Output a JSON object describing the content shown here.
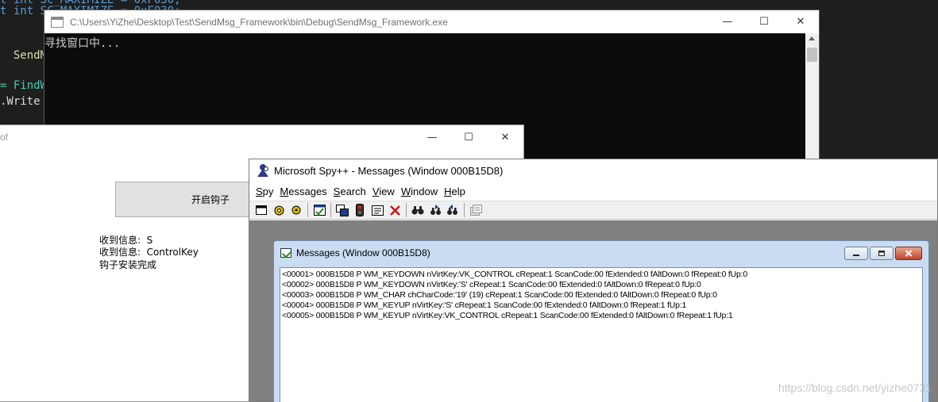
{
  "editor": {
    "lines": [
      {
        "text": "t int SC_MAXIMIZE = 0xF030;",
        "cls": "kw"
      },
      {
        "text": "  SendMs",
        "cls": "pale"
      },
      {
        "text": "= FindW",
        "cls": "grn"
      },
      {
        "text": ".Write",
        "cls": "ident"
      }
    ],
    "partial_top": "t int SC_MAXIMIZE = 0xF030;"
  },
  "console": {
    "title": "C:\\Users\\YiZhe\\Desktop\\Test\\SendMsg_Framework\\bin\\Debug\\SendMsg_Framework.exe",
    "output": "寻找窗口中...",
    "controls": {
      "minimize": "—",
      "maximize": "☐",
      "close": "✕"
    }
  },
  "hook_window": {
    "title": "of",
    "button_label": "开启钩子",
    "info": [
      "收到信息:  S",
      "收到信息:  ControlKey",
      "钩子安装完成"
    ],
    "controls": {
      "minimize": "—",
      "maximize": "☐",
      "close": "✕"
    }
  },
  "spy": {
    "title": "Microsoft Spy++ - Messages (Window 000B15D8)",
    "menu": [
      {
        "label": "Spy",
        "accel": "S",
        "rest": "py"
      },
      {
        "label": "Messages",
        "accel": "M",
        "rest": "essages"
      },
      {
        "label": "Search",
        "accel": "S",
        "rest": "earch"
      },
      {
        "label": "View",
        "accel": "V",
        "rest": "iew"
      },
      {
        "label": "Window",
        "accel": "W",
        "rest": "indow"
      },
      {
        "label": "Help",
        "accel": "H",
        "rest": "elp"
      }
    ],
    "toolbar_icons": [
      "windows-icon",
      "processes-icon",
      "threads-icon",
      "log-messages-icon",
      "find-window-icon",
      "start-logging-icon",
      "message-options-icon",
      "clear-icon",
      "find-icon",
      "find-next-icon",
      "find-previous-icon",
      "properties-icon"
    ],
    "messages_window": {
      "title": "Messages (Window 000B15D8)",
      "rows": [
        "<00001> 000B15D8 P WM_KEYDOWN nVirtKey:VK_CONTROL cRepeat:1 ScanCode:00 fExtended:0 fAltDown:0 fRepeat:0 fUp:0",
        "<00002> 000B15D8 P WM_KEYDOWN nVirtKey:'S' cRepeat:1 ScanCode:00 fExtended:0 fAltDown:0 fRepeat:0 fUp:0",
        "<00003> 000B15D8 P WM_CHAR chCharCode:'19' (19) cRepeat:1 ScanCode:00 fExtended:0 fAltDown:0 fRepeat:0 fUp:0",
        "<00004> 000B15D8 P WM_KEYUP nVirtKey:'S' cRepeat:1 ScanCode:00 fExtended:0 fAltDown:0 fRepeat:1 fUp:1",
        "<00005> 000B15D8 P WM_KEYUP nVirtKey:VK_CONTROL cRepeat:1 ScanCode:00 fExtended:0 fAltDown:0 fRepeat:1 fUp:1"
      ]
    }
  },
  "watermark": "https://blog.csdn.net/yizhe0731"
}
